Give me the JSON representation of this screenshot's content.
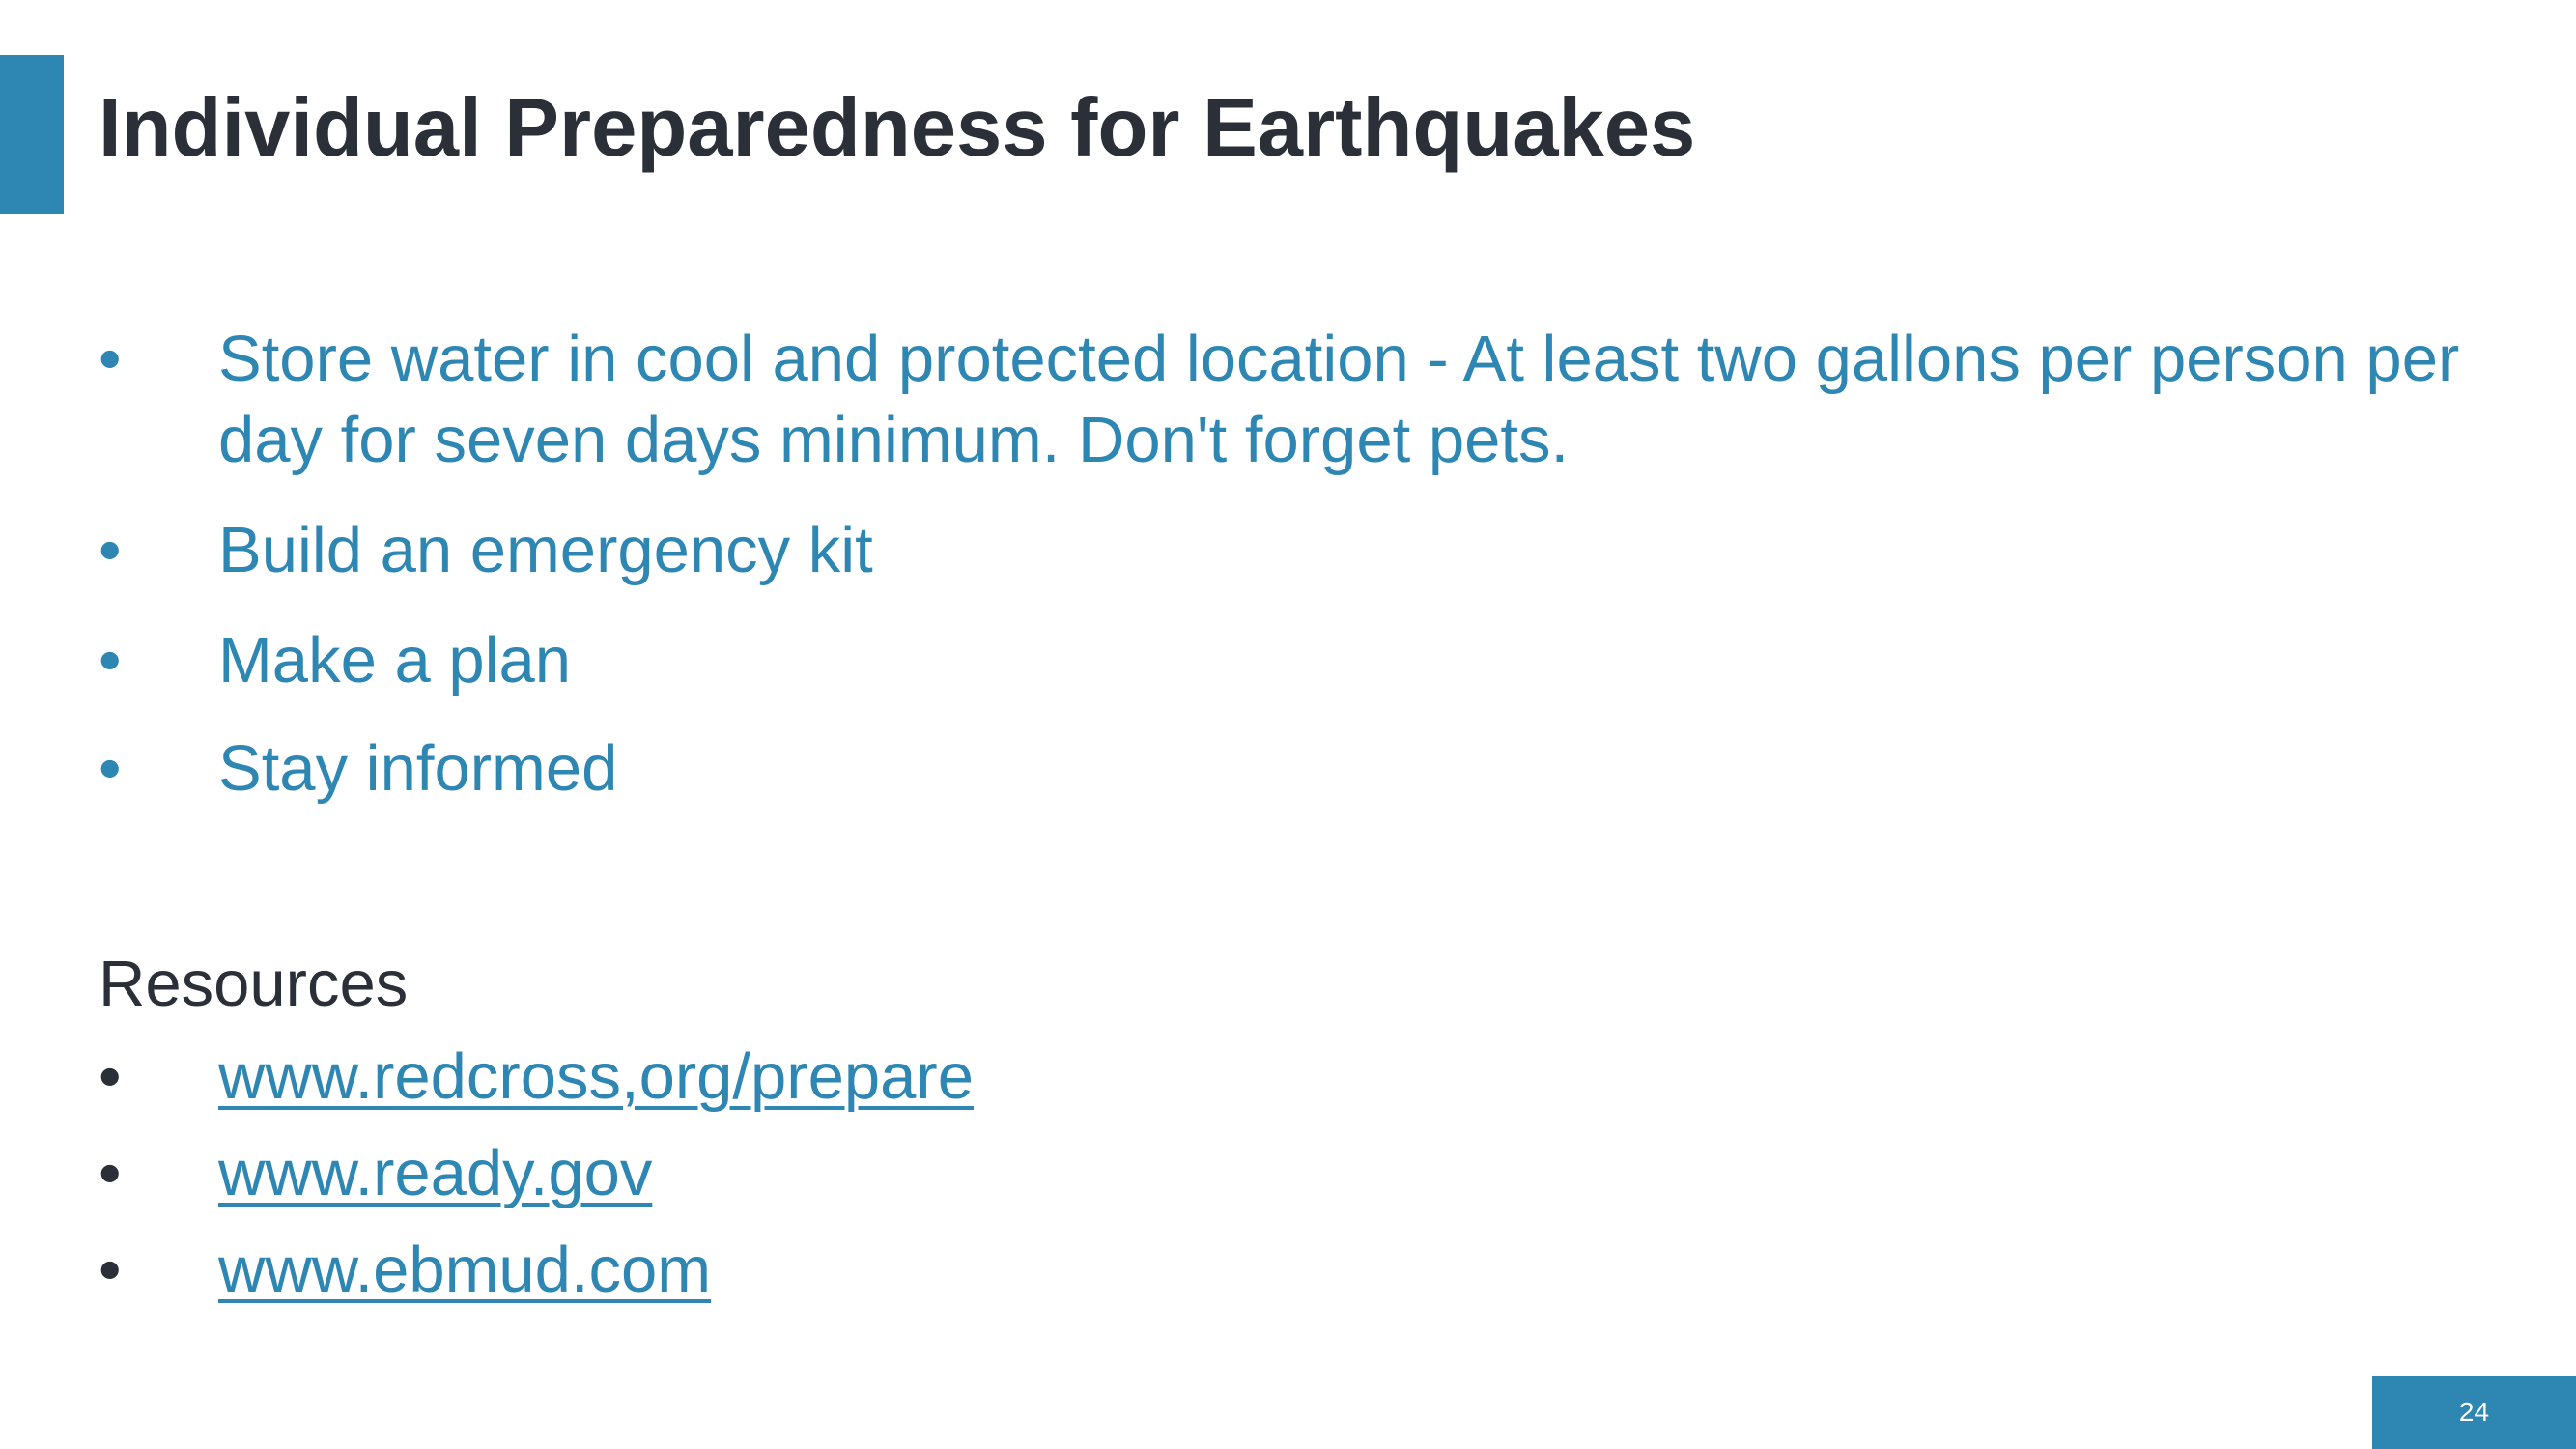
{
  "slide": {
    "title": "Individual Preparedness for Earthquakes",
    "page_number": "24",
    "bullet_symbol": "•",
    "accent_color": "#2e86b3",
    "text_color": "#2b2f38"
  },
  "bullets": [
    {
      "text": "Store water in cool and protected location - At least two gallons per person per day for seven days minimum. Don't forget pets."
    },
    {
      "text": "Build an emergency kit"
    },
    {
      "text": "Make a plan"
    },
    {
      "text": "Stay informed"
    }
  ],
  "resources": {
    "heading": "Resources",
    "links": [
      {
        "text": "www.redcross,org/prepare"
      },
      {
        "text": "www.ready.gov"
      },
      {
        "text": "www.ebmud.com"
      }
    ]
  }
}
